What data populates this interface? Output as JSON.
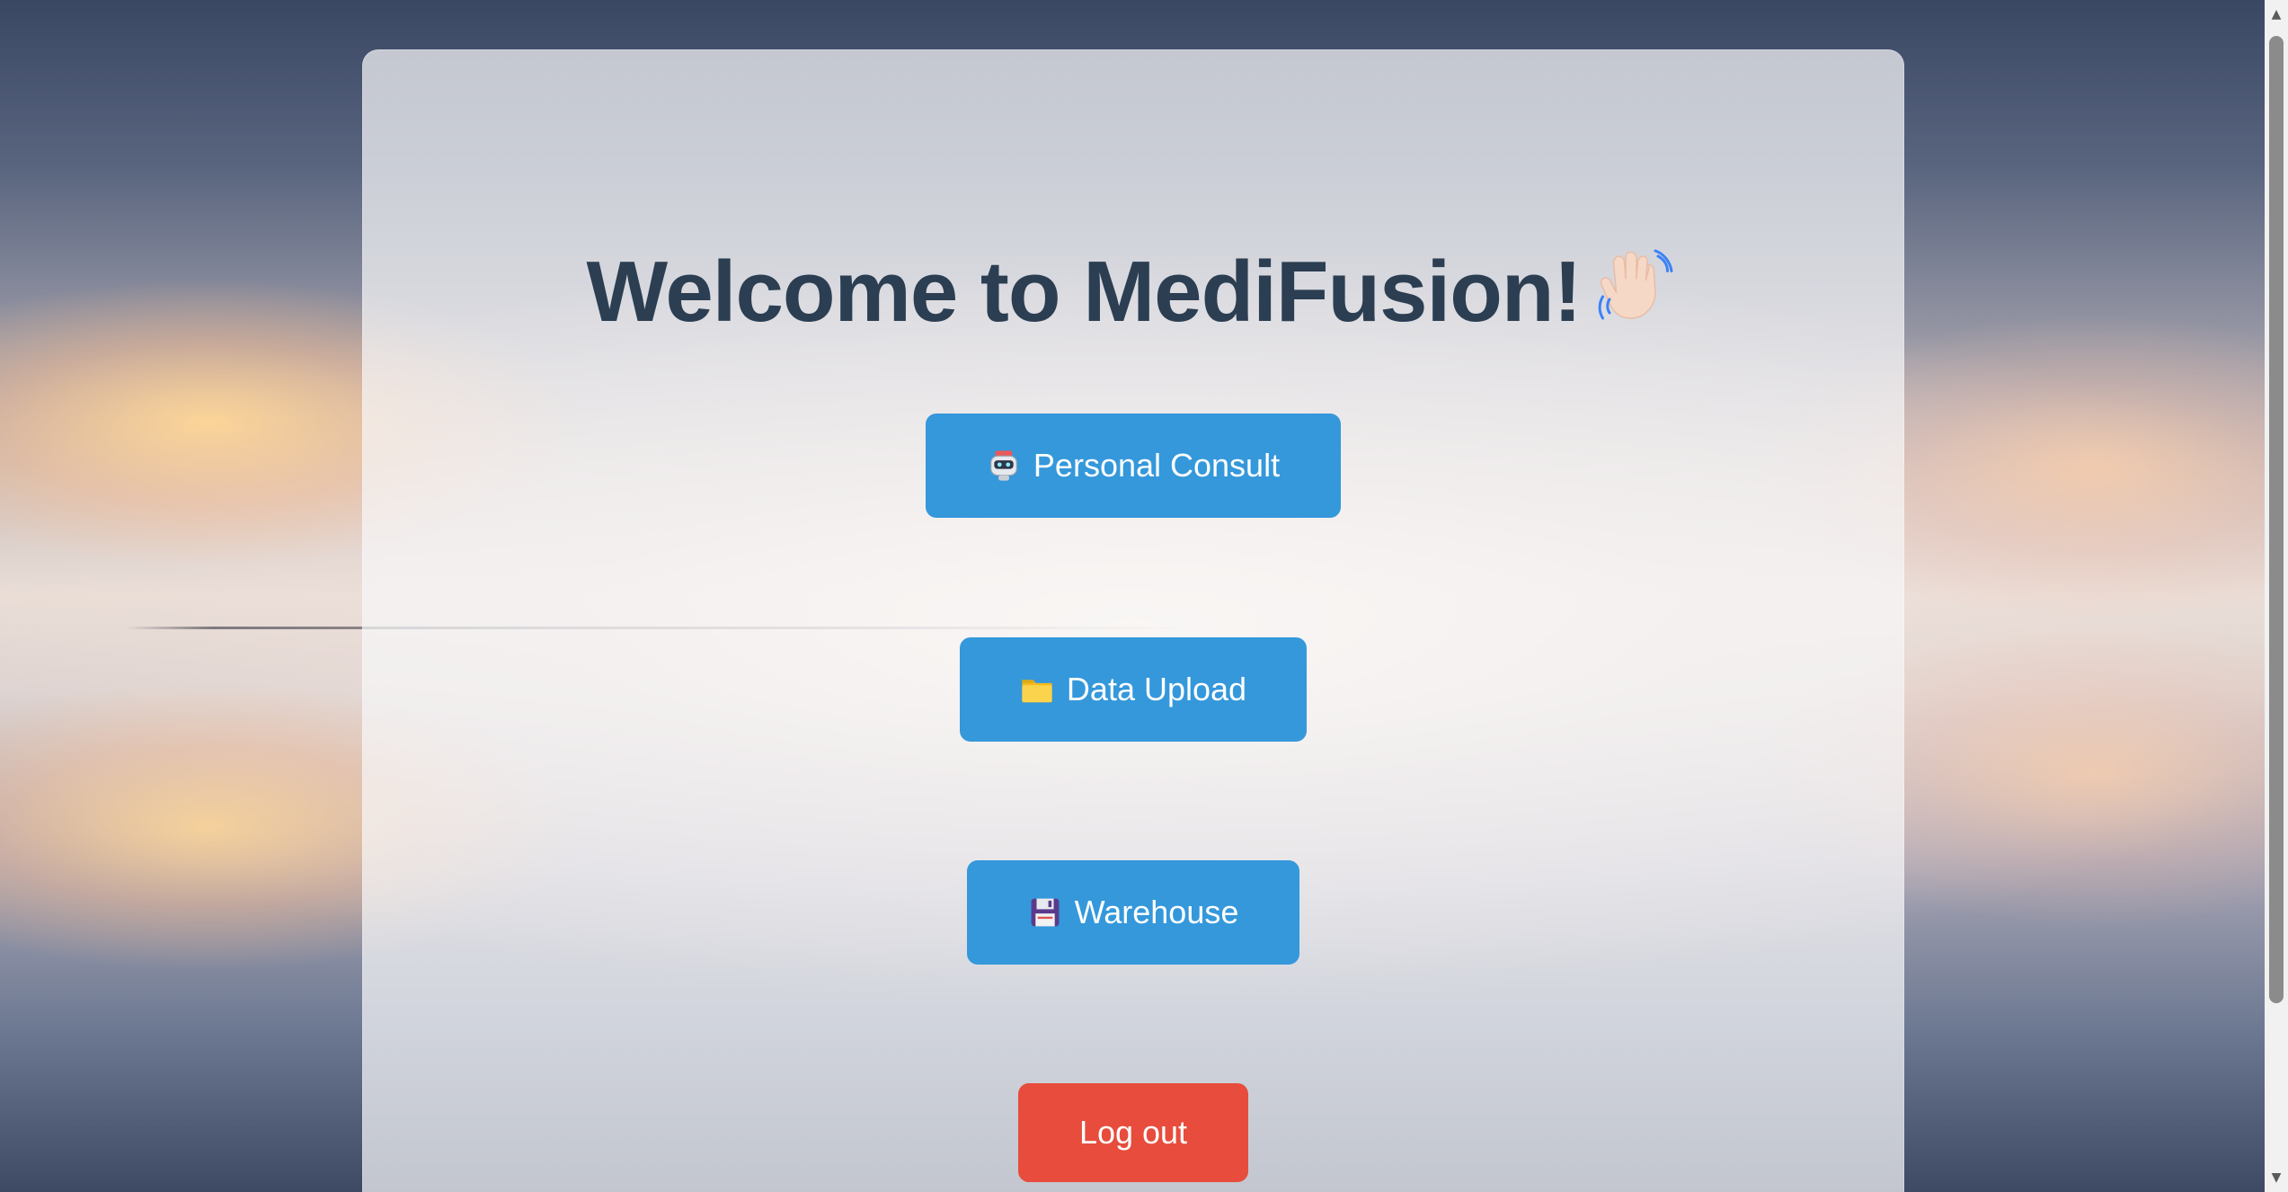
{
  "page": {
    "title": "Welcome to MediFusion!",
    "title_icon": "waving-hand-icon"
  },
  "menu": {
    "personal_consult": {
      "label": "Personal Consult",
      "icon": "robot-icon"
    },
    "data_upload": {
      "label": "Data Upload",
      "icon": "folder-icon"
    },
    "warehouse": {
      "label": "Warehouse",
      "icon": "floppy-disk-icon"
    }
  },
  "logout": {
    "label": "Log out"
  },
  "colors": {
    "primary_button": "#3498db",
    "logout_button": "#e74c3c",
    "title_text": "#2c3e52"
  }
}
